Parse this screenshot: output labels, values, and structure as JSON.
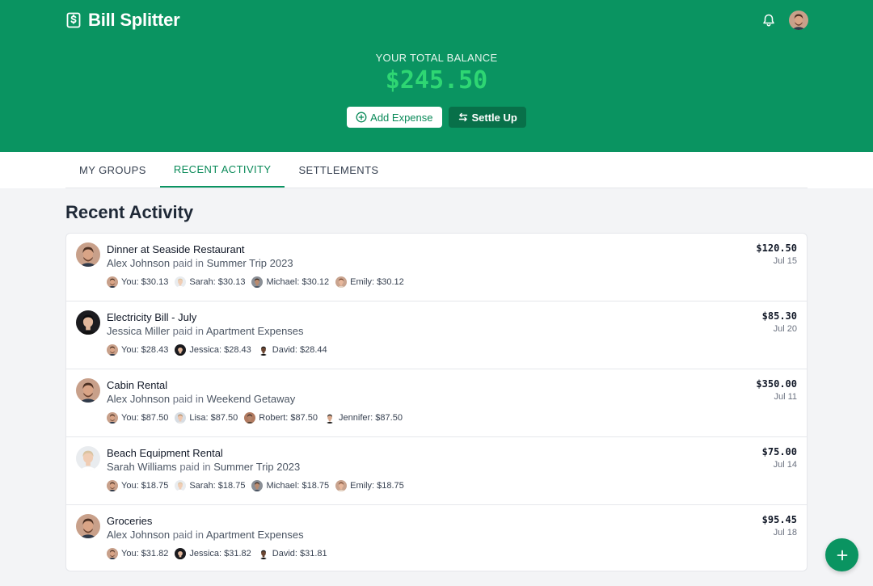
{
  "app": {
    "title": "Bill Splitter"
  },
  "colors": {
    "brand": "#0a9461",
    "balance": "#2ed673"
  },
  "balance": {
    "label": "YOUR TOTAL BALANCE",
    "amount": "$245.50"
  },
  "actions": {
    "add_label": "Add Expense",
    "settle_label": "Settle Up"
  },
  "tabs": [
    {
      "label": "MY GROUPS",
      "active": false
    },
    {
      "label": "RECENT ACTIVITY",
      "active": true
    },
    {
      "label": "SETTLEMENTS",
      "active": false
    }
  ],
  "section": {
    "title": "Recent Activity"
  },
  "activities": [
    {
      "title": "Dinner at Seaside Restaurant",
      "payer": "Alex Johnson",
      "paid_in": "paid in",
      "group": "Summer Trip 2023",
      "amount": "$120.50",
      "date": "Jul 15",
      "avatar": "alex",
      "shares": [
        {
          "label": "You: $30.13",
          "avatar": "alex"
        },
        {
          "label": "Sarah: $30.13",
          "avatar": "sarah"
        },
        {
          "label": "Michael: $30.12",
          "avatar": "michael"
        },
        {
          "label": "Emily: $30.12",
          "avatar": "emily"
        }
      ]
    },
    {
      "title": "Electricity Bill - July",
      "payer": "Jessica Miller",
      "paid_in": "paid in",
      "group": "Apartment Expenses",
      "amount": "$85.30",
      "date": "Jul 20",
      "avatar": "jessica",
      "shares": [
        {
          "label": "You: $28.43",
          "avatar": "alex"
        },
        {
          "label": "Jessica: $28.43",
          "avatar": "jessica"
        },
        {
          "label": "David: $28.44",
          "avatar": "david"
        }
      ]
    },
    {
      "title": "Cabin Rental",
      "payer": "Alex Johnson",
      "paid_in": "paid in",
      "group": "Weekend Getaway",
      "amount": "$350.00",
      "date": "Jul 11",
      "avatar": "alex",
      "shares": [
        {
          "label": "You: $87.50",
          "avatar": "alex"
        },
        {
          "label": "Lisa: $87.50",
          "avatar": "lisa"
        },
        {
          "label": "Robert: $87.50",
          "avatar": "robert"
        },
        {
          "label": "Jennifer: $87.50",
          "avatar": "jennifer"
        }
      ]
    },
    {
      "title": "Beach Equipment Rental",
      "payer": "Sarah Williams",
      "paid_in": "paid in",
      "group": "Summer Trip 2023",
      "amount": "$75.00",
      "date": "Jul 14",
      "avatar": "sarah",
      "shares": [
        {
          "label": "You: $18.75",
          "avatar": "alex"
        },
        {
          "label": "Sarah: $18.75",
          "avatar": "sarah"
        },
        {
          "label": "Michael: $18.75",
          "avatar": "michael"
        },
        {
          "label": "Emily: $18.75",
          "avatar": "emily"
        }
      ]
    },
    {
      "title": "Groceries",
      "payer": "Alex Johnson",
      "paid_in": "paid in",
      "group": "Apartment Expenses",
      "amount": "$95.45",
      "date": "Jul 18",
      "avatar": "alex",
      "shares": [
        {
          "label": "You: $31.82",
          "avatar": "alex"
        },
        {
          "label": "Jessica: $31.82",
          "avatar": "jessica"
        },
        {
          "label": "David: $31.81",
          "avatar": "david"
        }
      ]
    }
  ]
}
